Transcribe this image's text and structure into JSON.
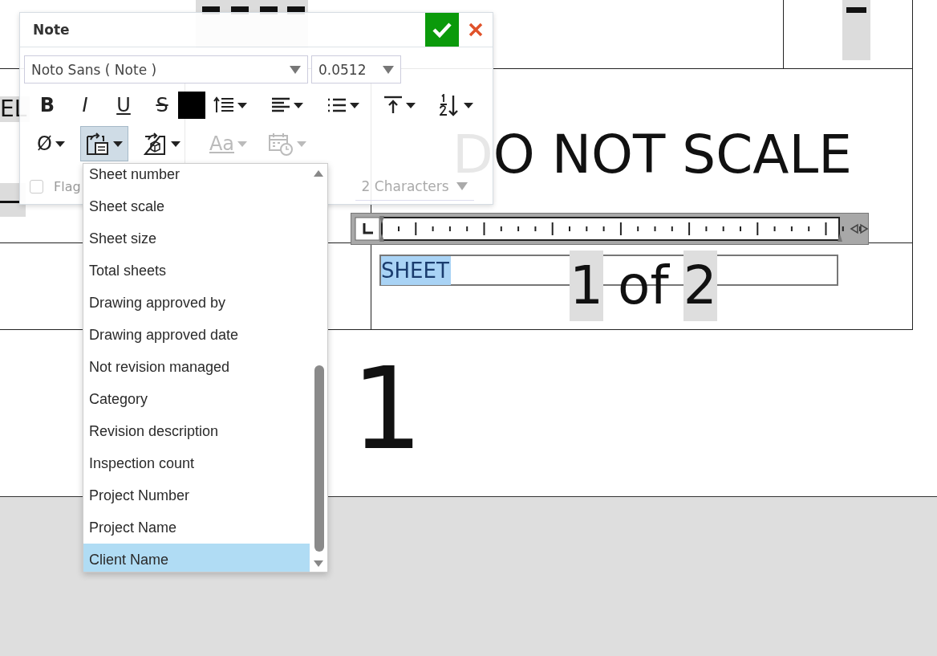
{
  "canvas": {
    "texts": [
      {
        "text": "EL"
      },
      {
        "text": "DO NOT SCALE"
      },
      {
        "text": "1"
      }
    ],
    "sheet_field": {
      "value": "SHEET",
      "selected": true
    },
    "sheet_count": [
      {
        "text": "1",
        "highlighted": true
      },
      {
        "text": "of",
        "highlighted": false
      },
      {
        "text": "2",
        "highlighted": true
      }
    ]
  },
  "dialog": {
    "title": "Note",
    "font": {
      "value": "Noto Sans ( Note )"
    },
    "size": {
      "value": "0.0512"
    },
    "toolbar": [
      {
        "kind": "bold",
        "text": "B",
        "dropdown": false
      },
      {
        "kind": "italic",
        "text": "I",
        "dropdown": false
      },
      {
        "kind": "underline",
        "text": "U",
        "dropdown": false
      },
      {
        "kind": "strike",
        "text": "S",
        "dropdown": false
      },
      {
        "kind": "color",
        "color": "#000000",
        "dropdown": false
      },
      {
        "kind": "line-spacing",
        "dropdown": true
      },
      {
        "kind": "align",
        "dropdown": true
      },
      {
        "kind": "list",
        "dropdown": true
      },
      {
        "kind": "valign",
        "dropdown": true
      },
      {
        "kind": "numbering",
        "dropdown": true
      }
    ],
    "toolbar2": [
      {
        "kind": "symbol",
        "text": "Ø",
        "dropdown": true,
        "selected": false,
        "disabled": false
      },
      {
        "kind": "field",
        "dropdown": true,
        "selected": true,
        "disabled": false
      },
      {
        "kind": "part",
        "dropdown": true,
        "selected": false,
        "disabled": false
      },
      {
        "kind": "case",
        "text": "Aa",
        "dropdown": true,
        "selected": false,
        "disabled": true
      },
      {
        "kind": "date",
        "dropdown": true,
        "selected": false,
        "disabled": true
      }
    ],
    "flag": {
      "label": "Flag",
      "checked": false
    },
    "characters": {
      "value": "2 Characters"
    }
  },
  "field_menu": {
    "items": [
      {
        "label": "Sheet number",
        "selected": false
      },
      {
        "label": "Sheet scale",
        "selected": false
      },
      {
        "label": "Sheet size",
        "selected": false
      },
      {
        "label": "Total sheets",
        "selected": false
      },
      {
        "label": "Drawing approved by",
        "selected": false
      },
      {
        "label": "Drawing approved date",
        "selected": false
      },
      {
        "label": "Not revision managed",
        "selected": false
      },
      {
        "label": "Category",
        "selected": false
      },
      {
        "label": "Revision description",
        "selected": false
      },
      {
        "label": "Inspection count",
        "selected": false
      },
      {
        "label": "Project Number",
        "selected": false
      },
      {
        "label": "Project Name",
        "selected": false
      },
      {
        "label": "Client Name",
        "selected": true
      }
    ]
  }
}
